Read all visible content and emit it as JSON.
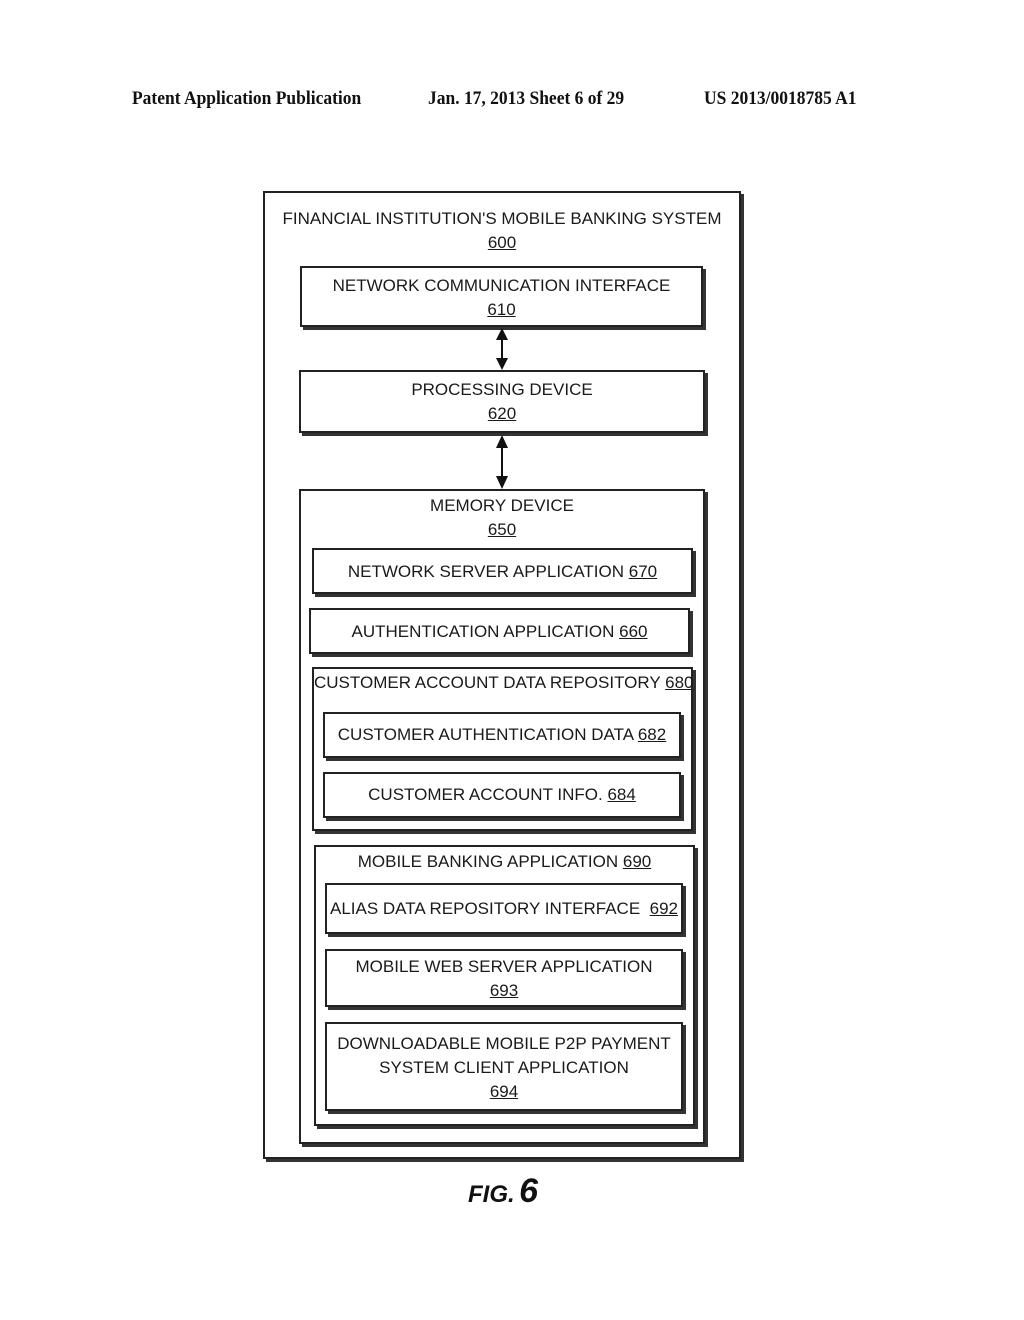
{
  "header": {
    "publication": "Patent Application Publication",
    "date_sheet": "Jan. 17, 2013   Sheet 6 of 29",
    "number": "US 2013/0018785 A1"
  },
  "diagram": {
    "system": {
      "label": "FINANCIAL INSTITUTION'S MOBILE BANKING SYSTEM",
      "ref": "600"
    },
    "network_interface": {
      "label": "NETWORK COMMUNICATION INTERFACE",
      "ref": "610"
    },
    "processing_device": {
      "label": "PROCESSING DEVICE",
      "ref": "620"
    },
    "memory_device": {
      "label": "MEMORY DEVICE",
      "ref": "650"
    },
    "network_server_app": {
      "label": "NETWORK SERVER APPLICATION",
      "ref": "670"
    },
    "authentication_app": {
      "label": "AUTHENTICATION APPLICATION",
      "ref": "660"
    },
    "customer_account_repo": {
      "label": "CUSTOMER ACCOUNT DATA REPOSITORY",
      "ref": "680"
    },
    "customer_auth_data": {
      "label": "CUSTOMER AUTHENTICATION DATA",
      "ref": "682"
    },
    "customer_account_info": {
      "label": "CUSTOMER ACCOUNT INFO.",
      "ref": "684"
    },
    "mobile_banking_app": {
      "label": "MOBILE BANKING APPLICATION",
      "ref": "690"
    },
    "alias_repo_interface": {
      "label": "ALIAS DATA REPOSITORY INTERFACE",
      "ref": "692"
    },
    "mobile_web_server_app": {
      "label": "MOBILE WEB SERVER APPLICATION",
      "ref": "693"
    },
    "p2p_client_app": {
      "label_line1": "DOWNLOADABLE MOBILE P2P PAYMENT",
      "label_line2": "SYSTEM CLIENT APPLICATION",
      "ref": "694"
    },
    "arrows": [
      "bidirectional 610-620",
      "bidirectional 620-650"
    ]
  },
  "figure": {
    "prefix": "FIG.",
    "number": "6"
  }
}
